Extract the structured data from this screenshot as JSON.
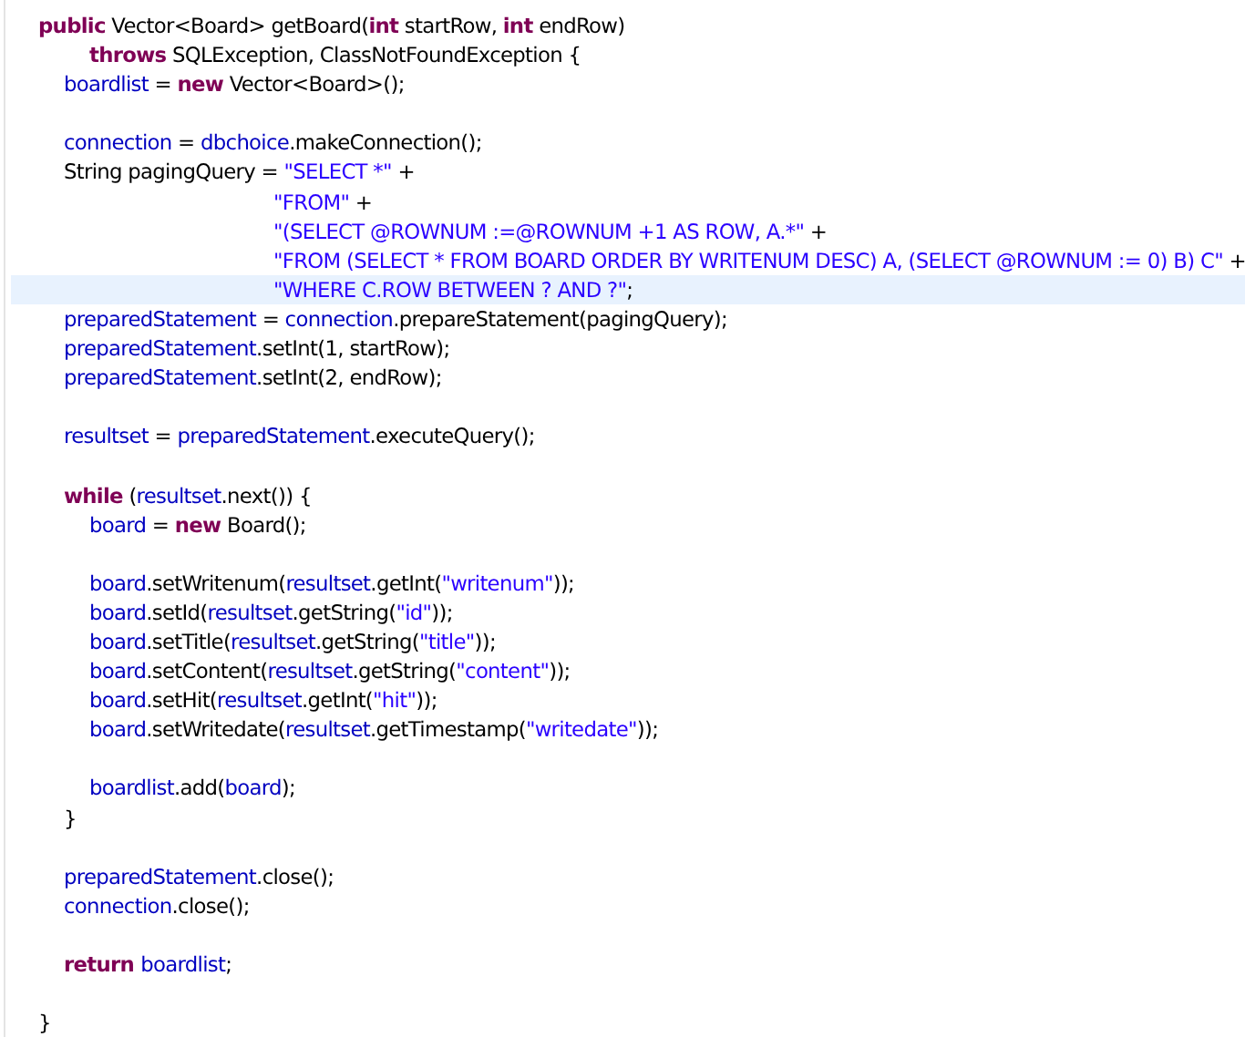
{
  "editor": {
    "lines": [
      {
        "kind": "code",
        "selected": false,
        "tokens": [
          {
            "kind": "keyword",
            "text": "public"
          },
          {
            "kind": "plain",
            "text": " Vector<Board> getBoard("
          },
          {
            "kind": "keyword",
            "text": "int"
          },
          {
            "kind": "plain",
            "text": " startRow, "
          },
          {
            "kind": "keyword",
            "text": "int"
          },
          {
            "kind": "plain",
            "text": " endRow)"
          }
        ],
        "children": [
          {
            "kind": "wrapped",
            "selected": false,
            "tokens": [
              {
                "kind": "keyword",
                "text": "throws"
              },
              {
                "kind": "plain",
                "text": " SQLException, ClassNotFoundException {"
              }
            ]
          },
          {
            "kind": "code",
            "selected": false,
            "tokens": [
              {
                "kind": "field",
                "text": "boardlist"
              },
              {
                "kind": "plain",
                "text": " = "
              },
              {
                "kind": "keyword",
                "text": "new"
              },
              {
                "kind": "plain",
                "text": " Vector<Board>();"
              }
            ]
          },
          {
            "kind": "blank",
            "selected": false
          },
          {
            "kind": "code",
            "selected": false,
            "tokens": [
              {
                "kind": "field",
                "text": "connection"
              },
              {
                "kind": "plain",
                "text": " = "
              },
              {
                "kind": "field",
                "text": "dbchoice"
              },
              {
                "kind": "plain",
                "text": ".makeConnection();"
              }
            ]
          },
          {
            "kind": "code",
            "selected": false,
            "tokens": [
              {
                "kind": "plain",
                "text": "String pagingQuery = "
              },
              {
                "kind": "string",
                "text": "\"SELECT *\""
              },
              {
                "kind": "plain",
                "text": " +"
              }
            ],
            "children": [
              {
                "kind": "aligned",
                "selected": false,
                "tokens": [
                  {
                    "kind": "string",
                    "text": "\"FROM\""
                  },
                  {
                    "kind": "plain",
                    "text": " +"
                  }
                ]
              },
              {
                "kind": "aligned",
                "selected": false,
                "tokens": [
                  {
                    "kind": "string",
                    "text": "\"(SELECT @ROWNUM :=@ROWNUM +1 AS ROW, A.*\""
                  },
                  {
                    "kind": "plain",
                    "text": " +"
                  }
                ]
              },
              {
                "kind": "aligned",
                "selected": false,
                "tokens": [
                  {
                    "kind": "string",
                    "text": "\"FROM (SELECT * FROM BOARD ORDER BY WRITENUM DESC) A, (SELECT @ROWNUM := 0) B) C\""
                  },
                  {
                    "kind": "plain",
                    "text": " +"
                  }
                ]
              },
              {
                "kind": "aligned",
                "selected": true,
                "tokens": [
                  {
                    "kind": "string",
                    "text": "\"WHERE C.ROW BETWEEN ? AND ?\""
                  },
                  {
                    "kind": "plain",
                    "text": ";"
                  }
                ]
              }
            ]
          },
          {
            "kind": "code",
            "selected": false,
            "tokens": [
              {
                "kind": "field",
                "text": "preparedStatement"
              },
              {
                "kind": "plain",
                "text": " = "
              },
              {
                "kind": "field",
                "text": "connection"
              },
              {
                "kind": "plain",
                "text": ".prepareStatement(pagingQuery);"
              }
            ]
          },
          {
            "kind": "code",
            "selected": false,
            "tokens": [
              {
                "kind": "field",
                "text": "preparedStatement"
              },
              {
                "kind": "plain",
                "text": ".setInt(1, startRow);"
              }
            ]
          },
          {
            "kind": "code",
            "selected": false,
            "tokens": [
              {
                "kind": "field",
                "text": "preparedStatement"
              },
              {
                "kind": "plain",
                "text": ".setInt(2, endRow);"
              }
            ]
          },
          {
            "kind": "blank",
            "selected": false
          },
          {
            "kind": "code",
            "selected": false,
            "tokens": [
              {
                "kind": "field",
                "text": "resultset"
              },
              {
                "kind": "plain",
                "text": " = "
              },
              {
                "kind": "field",
                "text": "preparedStatement"
              },
              {
                "kind": "plain",
                "text": ".executeQuery();"
              }
            ]
          },
          {
            "kind": "blank",
            "selected": false
          },
          {
            "kind": "code",
            "selected": false,
            "tokens": [
              {
                "kind": "keyword",
                "text": "while"
              },
              {
                "kind": "plain",
                "text": " ("
              },
              {
                "kind": "field",
                "text": "resultset"
              },
              {
                "kind": "plain",
                "text": ".next()) {"
              }
            ],
            "children": [
              {
                "kind": "code",
                "selected": false,
                "tokens": [
                  {
                    "kind": "field",
                    "text": "board"
                  },
                  {
                    "kind": "plain",
                    "text": " = "
                  },
                  {
                    "kind": "keyword",
                    "text": "new"
                  },
                  {
                    "kind": "plain",
                    "text": " Board();"
                  }
                ]
              },
              {
                "kind": "blank",
                "selected": false
              },
              {
                "kind": "code",
                "selected": false,
                "tokens": [
                  {
                    "kind": "field",
                    "text": "board"
                  },
                  {
                    "kind": "plain",
                    "text": ".setWritenum("
                  },
                  {
                    "kind": "field",
                    "text": "resultset"
                  },
                  {
                    "kind": "plain",
                    "text": ".getInt("
                  },
                  {
                    "kind": "string",
                    "text": "\"writenum\""
                  },
                  {
                    "kind": "plain",
                    "text": "));"
                  }
                ]
              },
              {
                "kind": "code",
                "selected": false,
                "tokens": [
                  {
                    "kind": "field",
                    "text": "board"
                  },
                  {
                    "kind": "plain",
                    "text": ".setId("
                  },
                  {
                    "kind": "field",
                    "text": "resultset"
                  },
                  {
                    "kind": "plain",
                    "text": ".getString("
                  },
                  {
                    "kind": "string",
                    "text": "\"id\""
                  },
                  {
                    "kind": "plain",
                    "text": "));"
                  }
                ]
              },
              {
                "kind": "code",
                "selected": false,
                "tokens": [
                  {
                    "kind": "field",
                    "text": "board"
                  },
                  {
                    "kind": "plain",
                    "text": ".setTitle("
                  },
                  {
                    "kind": "field",
                    "text": "resultset"
                  },
                  {
                    "kind": "plain",
                    "text": ".getString("
                  },
                  {
                    "kind": "string",
                    "text": "\"title\""
                  },
                  {
                    "kind": "plain",
                    "text": "));"
                  }
                ]
              },
              {
                "kind": "code",
                "selected": false,
                "tokens": [
                  {
                    "kind": "field",
                    "text": "board"
                  },
                  {
                    "kind": "plain",
                    "text": ".setContent("
                  },
                  {
                    "kind": "field",
                    "text": "resultset"
                  },
                  {
                    "kind": "plain",
                    "text": ".getString("
                  },
                  {
                    "kind": "string",
                    "text": "\"content\""
                  },
                  {
                    "kind": "plain",
                    "text": "));"
                  }
                ]
              },
              {
                "kind": "code",
                "selected": false,
                "tokens": [
                  {
                    "kind": "field",
                    "text": "board"
                  },
                  {
                    "kind": "plain",
                    "text": ".setHit("
                  },
                  {
                    "kind": "field",
                    "text": "resultset"
                  },
                  {
                    "kind": "plain",
                    "text": ".getInt("
                  },
                  {
                    "kind": "string",
                    "text": "\"hit\""
                  },
                  {
                    "kind": "plain",
                    "text": "));"
                  }
                ]
              },
              {
                "kind": "code",
                "selected": false,
                "tokens": [
                  {
                    "kind": "field",
                    "text": "board"
                  },
                  {
                    "kind": "plain",
                    "text": ".setWritedate("
                  },
                  {
                    "kind": "field",
                    "text": "resultset"
                  },
                  {
                    "kind": "plain",
                    "text": ".getTimestamp("
                  },
                  {
                    "kind": "string",
                    "text": "\"writedate\""
                  },
                  {
                    "kind": "plain",
                    "text": "));"
                  }
                ]
              },
              {
                "kind": "blank",
                "selected": false
              },
              {
                "kind": "code",
                "selected": false,
                "tokens": [
                  {
                    "kind": "field",
                    "text": "boardlist"
                  },
                  {
                    "kind": "plain",
                    "text": ".add("
                  },
                  {
                    "kind": "field",
                    "text": "board"
                  },
                  {
                    "kind": "plain",
                    "text": ");"
                  }
                ]
              }
            ]
          },
          {
            "kind": "code",
            "selected": false,
            "tokens": [
              {
                "kind": "plain",
                "text": "}"
              }
            ]
          },
          {
            "kind": "blank",
            "selected": false
          },
          {
            "kind": "code",
            "selected": false,
            "tokens": [
              {
                "kind": "field",
                "text": "preparedStatement"
              },
              {
                "kind": "plain",
                "text": ".close();"
              }
            ]
          },
          {
            "kind": "code",
            "selected": false,
            "tokens": [
              {
                "kind": "field",
                "text": "connection"
              },
              {
                "kind": "plain",
                "text": ".close();"
              }
            ]
          },
          {
            "kind": "blank",
            "selected": false
          },
          {
            "kind": "code",
            "selected": false,
            "tokens": [
              {
                "kind": "keyword",
                "text": "return "
              },
              {
                "kind": "field",
                "text": "boardlist"
              },
              {
                "kind": "plain",
                "text": ";"
              }
            ]
          },
          {
            "kind": "blank",
            "selected": false
          }
        ]
      },
      {
        "kind": "code",
        "selected": false,
        "tokens": [
          {
            "kind": "plain",
            "text": "}"
          }
        ]
      }
    ]
  }
}
